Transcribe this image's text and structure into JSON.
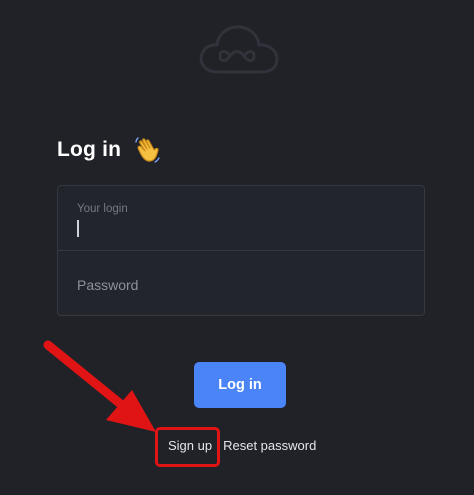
{
  "logo": {
    "icon": "cloud-infinity-icon"
  },
  "login": {
    "heading": "Log in",
    "heading_emoji": "waving-hand-icon"
  },
  "form": {
    "login_placeholder": "Your login",
    "password_placeholder": "Password"
  },
  "actions": {
    "login_button": "Log in",
    "signup_link": "Sign up",
    "reset_link": "Reset password"
  },
  "colors": {
    "background": "#202228",
    "accent": "#4a84f6",
    "annotation": "#e01414"
  }
}
